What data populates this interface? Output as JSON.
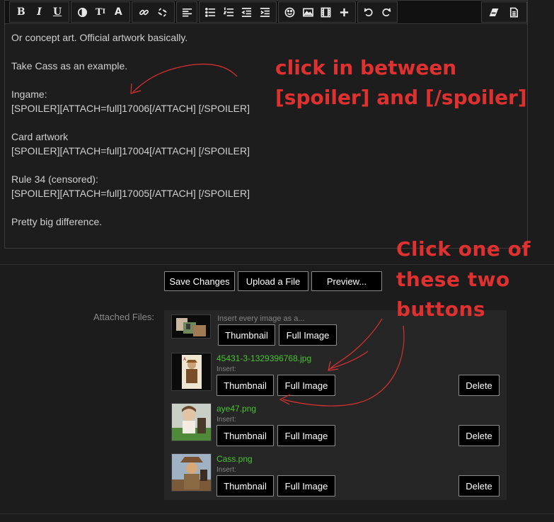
{
  "toolbar": {
    "groups": [
      [
        "bold-icon",
        "italic-icon",
        "underline-icon"
      ],
      [
        "text-color-icon",
        "font-size-icon",
        "font-family-icon"
      ],
      [
        "link-icon",
        "unlink-icon"
      ],
      [
        "align-icon"
      ],
      [
        "bullet-list-icon",
        "numbered-list-icon",
        "outdent-icon",
        "indent-icon"
      ],
      [
        "smilie-icon",
        "image-icon",
        "media-icon",
        "insert-more-icon"
      ],
      [
        "undo-icon",
        "redo-icon"
      ],
      [
        "remove-formatting-icon",
        "bbcode-toggle-icon"
      ]
    ],
    "bold_label": "B",
    "italic_label": "I",
    "underline_label": "U"
  },
  "editor": {
    "lines": [
      "Or concept art. Official artwork basically.",
      "",
      "Take Cass as an example.",
      "",
      "Ingame:",
      "[SPOILER][ATTACH=full]17006[/ATTACH] [/SPOILER]",
      "",
      "Card artwork",
      "[SPOILER][ATTACH=full]17004[/ATTACH] [/SPOILER]",
      "",
      "Rule 34 (censored):",
      "[SPOILER][ATTACH=full]17005[/ATTACH] [/SPOILER]",
      "",
      "Pretty big difference."
    ]
  },
  "annotations": {
    "note1": "click in between\n[spoiler] and [/spoiler]",
    "note2": "Click one of\nthese two\nbuttons",
    "color": "#e03131"
  },
  "actions": {
    "save": "Save Changes",
    "upload": "Upload a File",
    "preview": "Preview..."
  },
  "attachments": {
    "label": "Attached Files:",
    "insert_all_text": "Insert every image as a...",
    "thumbnail_label": "Thumbnail",
    "full_image_label": "Full Image",
    "delete_label": "Delete",
    "insert_label": "Insert:",
    "files": [
      {
        "name": "45431-3-1329396768.jpg"
      },
      {
        "name": "aye47.png"
      },
      {
        "name": "Cass.png"
      }
    ]
  },
  "colors": {
    "background": "#1c1c1c",
    "filename": "#48c431",
    "annotation": "#e03131"
  }
}
